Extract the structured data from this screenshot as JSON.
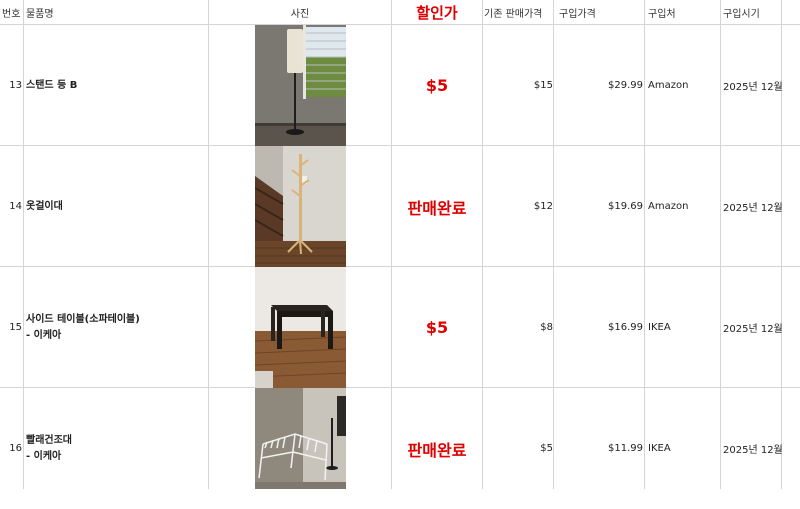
{
  "headers": {
    "no": "번호",
    "item": "물품명",
    "photo": "사진",
    "sale_price": "할인가",
    "original_price": "기존 판매가격",
    "purchase_price": "구입가격",
    "store": "구입처",
    "purchase_date": "구입시기"
  },
  "rows": [
    {
      "no": "13",
      "name_line1": "스탠드 등 B",
      "name_line2": "",
      "photo": "floor-lamp",
      "sale_price": "$5",
      "original_price": "$15",
      "purchase_price": "$29.99",
      "store": "Amazon",
      "purchase_date": "2025년 12월"
    },
    {
      "no": "14",
      "name_line1": "옷걸이대",
      "name_line2": "",
      "photo": "coat-rack",
      "sale_price": "판매완료",
      "original_price": "$12",
      "purchase_price": "$19.69",
      "store": "Amazon",
      "purchase_date": "2025년 12월"
    },
    {
      "no": "15",
      "name_line1": "사이드 테이블(소파테이블)",
      "name_line2": "- 이케아",
      "photo": "side-table",
      "sale_price": "$5",
      "original_price": "$8",
      "purchase_price": "$16.99",
      "store": "IKEA",
      "purchase_date": "2025년 12월"
    },
    {
      "no": "16",
      "name_line1": "빨래건조대",
      "name_line2": "- 이케아",
      "photo": "drying-rack",
      "sale_price": "판매완료",
      "original_price": "$5",
      "purchase_price": "$11.99",
      "store": "IKEA",
      "purchase_date": "2025년 12월"
    }
  ],
  "colors": {
    "sale_red": "#e00000",
    "grid": "#d4d4d4"
  }
}
